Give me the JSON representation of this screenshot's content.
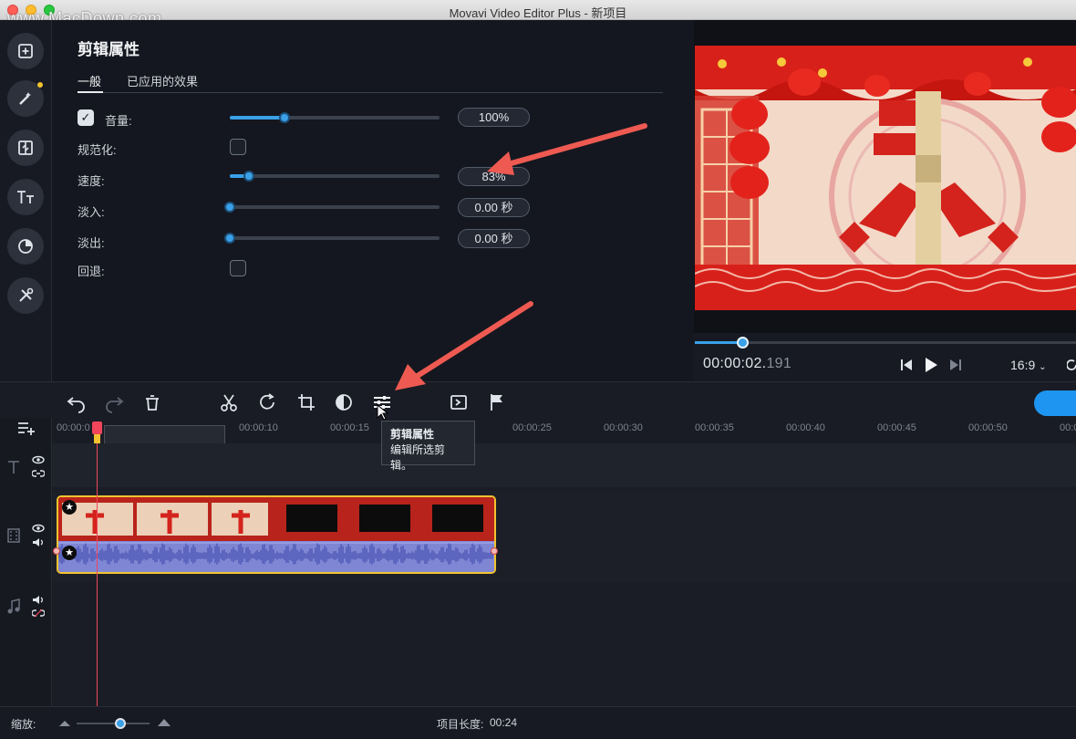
{
  "window": {
    "title": "Movavi Video Editor Plus - 新项目",
    "watermark": "www.MacDown.com"
  },
  "sidebar": {
    "items": [
      {
        "name": "import-icon"
      },
      {
        "name": "magic-wand-icon",
        "badge": true
      },
      {
        "name": "transitions-icon"
      },
      {
        "name": "titles-icon"
      },
      {
        "name": "stickers-icon"
      },
      {
        "name": "tools-icon"
      }
    ]
  },
  "properties": {
    "heading": "剪辑属性",
    "tabs": [
      {
        "label": "一般",
        "active": true
      },
      {
        "label": "已应用的效果",
        "active": false
      }
    ],
    "volume": {
      "label": "音量:",
      "checked": true,
      "value_text": "100%",
      "level": 0.26
    },
    "normalize": {
      "label": "规范化:",
      "checked": false
    },
    "speed": {
      "label": "速度:",
      "value_text": "83%",
      "level": 0.09
    },
    "fade_in": {
      "label": "淡入:",
      "value_text": "0.00 秒",
      "level": 0.0
    },
    "fade_out": {
      "label": "淡出:",
      "value_text": "0.00 秒",
      "level": 0.0
    },
    "reverse": {
      "label": "回退:",
      "checked": false
    }
  },
  "preview": {
    "time_main": "00:00:02.",
    "time_ms": "191",
    "aspect": "16:9",
    "progress": 0.125
  },
  "timeline": {
    "ticks": [
      "00:00:0",
      "00:00:10",
      "00:00:15",
      "00:00:25",
      "00:00:30",
      "00:00:35",
      "00:00:40",
      "00:00:45",
      "00:00:50",
      "00:0"
    ],
    "tooltip": {
      "title": "剪辑属性",
      "text": "编辑所选剪辑。"
    }
  },
  "bottom": {
    "zoom_label": "缩放:",
    "zoom_level": 0.6,
    "length_label": "项目长度:",
    "length_value": "00:24"
  },
  "colors": {
    "accent": "#3aa0e8",
    "clip_border": "#f2c230",
    "playhead": "#f0455a",
    "annotation": "#ee5a52"
  }
}
